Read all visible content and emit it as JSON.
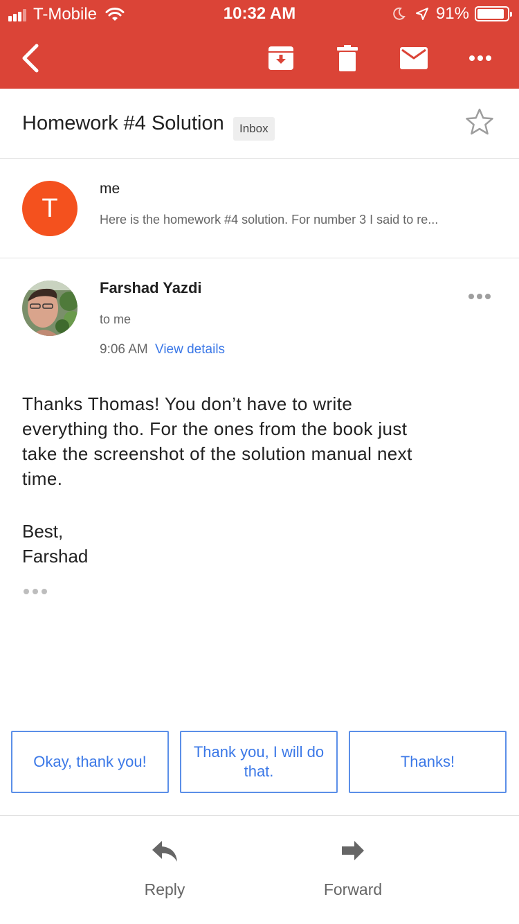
{
  "status_bar": {
    "carrier": "T-Mobile",
    "time": "10:32 AM",
    "battery": "91%",
    "battery_level": 0.91
  },
  "app_bar": {
    "back_icon": "chevron-left-icon",
    "actions": [
      "archive-icon",
      "trash-icon",
      "mail-icon",
      "more-horizontal-icon"
    ]
  },
  "thread": {
    "subject": "Homework #4 Solution",
    "label": "Inbox"
  },
  "collapsed_message": {
    "avatar_letter": "T",
    "avatar_color": "#f4511e",
    "sender": "me",
    "snippet": "Here is the homework #4 solution. For number 3 I said to re..."
  },
  "message": {
    "sender": "Farshad Yazdi",
    "recipient": "to me",
    "time": "9:06 AM",
    "view_details": "View details",
    "body_lines": [
      "Thanks Thomas! You don’t have to write",
      "everything tho. For the ones from the book just",
      "take the screenshot of the solution manual next",
      "time."
    ],
    "closing": "Best,",
    "signature": "Farshad"
  },
  "smart_replies": [
    "Okay, thank you!",
    "Thank you, I will do that.",
    "Thanks!"
  ],
  "bottom_actions": {
    "reply": "Reply",
    "forward": "Forward"
  },
  "colors": {
    "app_bar": "#db4437",
    "link": "#3b78e7"
  }
}
